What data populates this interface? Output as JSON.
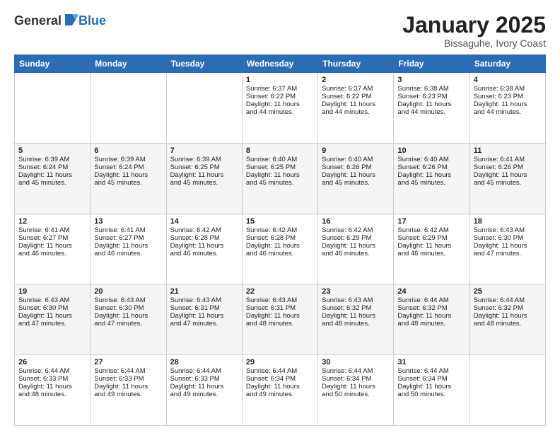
{
  "logo": {
    "general": "General",
    "blue": "Blue"
  },
  "title": "January 2025",
  "subtitle": "Bissaguhe, Ivory Coast",
  "days": [
    "Sunday",
    "Monday",
    "Tuesday",
    "Wednesday",
    "Thursday",
    "Friday",
    "Saturday"
  ],
  "weeks": [
    [
      {
        "num": "",
        "lines": []
      },
      {
        "num": "",
        "lines": []
      },
      {
        "num": "",
        "lines": []
      },
      {
        "num": "1",
        "lines": [
          "Sunrise: 6:37 AM",
          "Sunset: 6:22 PM",
          "Daylight: 11 hours",
          "and 44 minutes."
        ]
      },
      {
        "num": "2",
        "lines": [
          "Sunrise: 6:37 AM",
          "Sunset: 6:22 PM",
          "Daylight: 11 hours",
          "and 44 minutes."
        ]
      },
      {
        "num": "3",
        "lines": [
          "Sunrise: 6:38 AM",
          "Sunset: 6:23 PM",
          "Daylight: 11 hours",
          "and 44 minutes."
        ]
      },
      {
        "num": "4",
        "lines": [
          "Sunrise: 6:38 AM",
          "Sunset: 6:23 PM",
          "Daylight: 11 hours",
          "and 44 minutes."
        ]
      }
    ],
    [
      {
        "num": "5",
        "lines": [
          "Sunrise: 6:39 AM",
          "Sunset: 6:24 PM",
          "Daylight: 11 hours",
          "and 45 minutes."
        ]
      },
      {
        "num": "6",
        "lines": [
          "Sunrise: 6:39 AM",
          "Sunset: 6:24 PM",
          "Daylight: 11 hours",
          "and 45 minutes."
        ]
      },
      {
        "num": "7",
        "lines": [
          "Sunrise: 6:39 AM",
          "Sunset: 6:25 PM",
          "Daylight: 11 hours",
          "and 45 minutes."
        ]
      },
      {
        "num": "8",
        "lines": [
          "Sunrise: 6:40 AM",
          "Sunset: 6:25 PM",
          "Daylight: 11 hours",
          "and 45 minutes."
        ]
      },
      {
        "num": "9",
        "lines": [
          "Sunrise: 6:40 AM",
          "Sunset: 6:26 PM",
          "Daylight: 11 hours",
          "and 45 minutes."
        ]
      },
      {
        "num": "10",
        "lines": [
          "Sunrise: 6:40 AM",
          "Sunset: 6:26 PM",
          "Daylight: 11 hours",
          "and 45 minutes."
        ]
      },
      {
        "num": "11",
        "lines": [
          "Sunrise: 6:41 AM",
          "Sunset: 6:26 PM",
          "Daylight: 11 hours",
          "and 45 minutes."
        ]
      }
    ],
    [
      {
        "num": "12",
        "lines": [
          "Sunrise: 6:41 AM",
          "Sunset: 6:27 PM",
          "Daylight: 11 hours",
          "and 46 minutes."
        ]
      },
      {
        "num": "13",
        "lines": [
          "Sunrise: 6:41 AM",
          "Sunset: 6:27 PM",
          "Daylight: 11 hours",
          "and 46 minutes."
        ]
      },
      {
        "num": "14",
        "lines": [
          "Sunrise: 6:42 AM",
          "Sunset: 6:28 PM",
          "Daylight: 11 hours",
          "and 46 minutes."
        ]
      },
      {
        "num": "15",
        "lines": [
          "Sunrise: 6:42 AM",
          "Sunset: 6:28 PM",
          "Daylight: 11 hours",
          "and 46 minutes."
        ]
      },
      {
        "num": "16",
        "lines": [
          "Sunrise: 6:42 AM",
          "Sunset: 6:29 PM",
          "Daylight: 11 hours",
          "and 46 minutes."
        ]
      },
      {
        "num": "17",
        "lines": [
          "Sunrise: 6:42 AM",
          "Sunset: 6:29 PM",
          "Daylight: 11 hours",
          "and 46 minutes."
        ]
      },
      {
        "num": "18",
        "lines": [
          "Sunrise: 6:43 AM",
          "Sunset: 6:30 PM",
          "Daylight: 11 hours",
          "and 47 minutes."
        ]
      }
    ],
    [
      {
        "num": "19",
        "lines": [
          "Sunrise: 6:43 AM",
          "Sunset: 6:30 PM",
          "Daylight: 11 hours",
          "and 47 minutes."
        ]
      },
      {
        "num": "20",
        "lines": [
          "Sunrise: 6:43 AM",
          "Sunset: 6:30 PM",
          "Daylight: 11 hours",
          "and 47 minutes."
        ]
      },
      {
        "num": "21",
        "lines": [
          "Sunrise: 6:43 AM",
          "Sunset: 6:31 PM",
          "Daylight: 11 hours",
          "and 47 minutes."
        ]
      },
      {
        "num": "22",
        "lines": [
          "Sunrise: 6:43 AM",
          "Sunset: 6:31 PM",
          "Daylight: 11 hours",
          "and 48 minutes."
        ]
      },
      {
        "num": "23",
        "lines": [
          "Sunrise: 6:43 AM",
          "Sunset: 6:32 PM",
          "Daylight: 11 hours",
          "and 48 minutes."
        ]
      },
      {
        "num": "24",
        "lines": [
          "Sunrise: 6:44 AM",
          "Sunset: 6:32 PM",
          "Daylight: 11 hours",
          "and 48 minutes."
        ]
      },
      {
        "num": "25",
        "lines": [
          "Sunrise: 6:44 AM",
          "Sunset: 6:32 PM",
          "Daylight: 11 hours",
          "and 48 minutes."
        ]
      }
    ],
    [
      {
        "num": "26",
        "lines": [
          "Sunrise: 6:44 AM",
          "Sunset: 6:33 PM",
          "Daylight: 11 hours",
          "and 48 minutes."
        ]
      },
      {
        "num": "27",
        "lines": [
          "Sunrise: 6:44 AM",
          "Sunset: 6:33 PM",
          "Daylight: 11 hours",
          "and 49 minutes."
        ]
      },
      {
        "num": "28",
        "lines": [
          "Sunrise: 6:44 AM",
          "Sunset: 6:33 PM",
          "Daylight: 11 hours",
          "and 49 minutes."
        ]
      },
      {
        "num": "29",
        "lines": [
          "Sunrise: 6:44 AM",
          "Sunset: 6:34 PM",
          "Daylight: 11 hours",
          "and 49 minutes."
        ]
      },
      {
        "num": "30",
        "lines": [
          "Sunrise: 6:44 AM",
          "Sunset: 6:34 PM",
          "Daylight: 11 hours",
          "and 50 minutes."
        ]
      },
      {
        "num": "31",
        "lines": [
          "Sunrise: 6:44 AM",
          "Sunset: 6:34 PM",
          "Daylight: 11 hours",
          "and 50 minutes."
        ]
      },
      {
        "num": "",
        "lines": []
      }
    ]
  ]
}
